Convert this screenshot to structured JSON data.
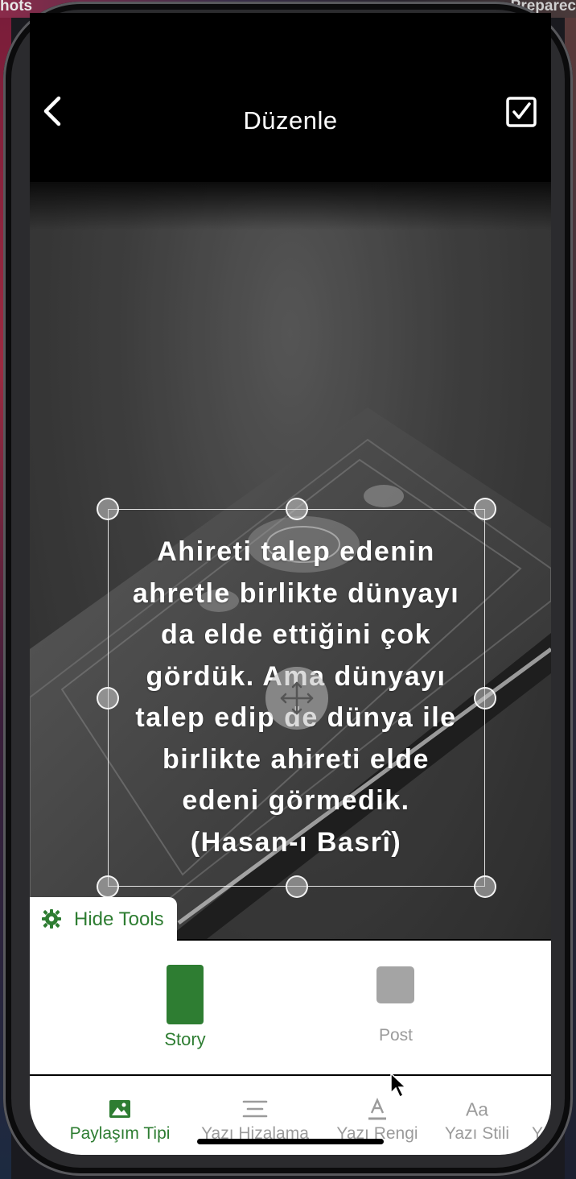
{
  "desktop": {
    "left_text": "hots",
    "right_text": "Preparec"
  },
  "header": {
    "title": "Düzenle",
    "back_icon": "chevron-left-icon",
    "confirm_icon": "checkbox-checked-icon"
  },
  "canvas": {
    "quote_lines": [
      "Ahireti talep edenin",
      "ahretle birlikte dünyayı",
      "da elde ettiğini çok",
      "gördük. Ama dünyayı",
      "talep edip de dünya ile",
      "birlikte ahireti elde",
      "edeni görmedik.",
      "(Hasan-ı Basrî)"
    ],
    "move_icon": "move-arrows-icon"
  },
  "tools": {
    "hide_label": "Hide Tools",
    "icon": "gear-icon",
    "accent": "#2e7d32"
  },
  "share_types": [
    {
      "label": "Story",
      "selected": true
    },
    {
      "label": "Post",
      "selected": false
    }
  ],
  "tabs": [
    {
      "label": "Paylaşım Tipi",
      "icon": "image-icon",
      "active": true
    },
    {
      "label": "Yazı Hizalama",
      "icon": "align-center-icon",
      "active": false
    },
    {
      "label": "Yazı Rengi",
      "icon": "text-color-icon",
      "active": false
    },
    {
      "label": "Yazı Stili",
      "icon": "text-style-icon",
      "active": false
    },
    {
      "label": "Y",
      "icon": "",
      "active": false
    }
  ]
}
